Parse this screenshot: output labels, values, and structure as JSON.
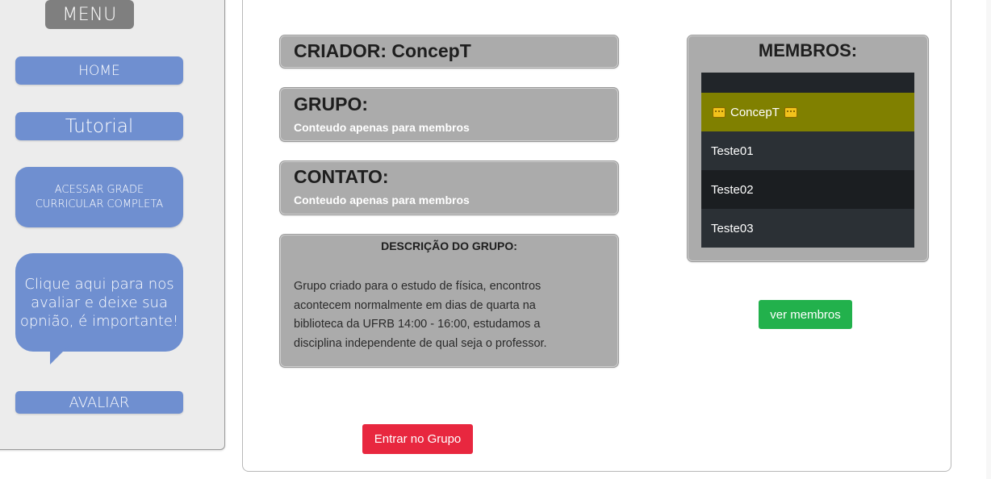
{
  "sidebar": {
    "menu_title": "MENU",
    "home_label": "HOME",
    "tutorial_label": "Tutorial",
    "grade_label": "ACESSAR GRADE CURRICULAR COMPLETA",
    "feedback_bubble": "Clique aqui para nos avaliar e deixe sua opnião, é importante!",
    "avaliar_label": "AVALIAR"
  },
  "group": {
    "criador": "CRIADOR: ConcepT",
    "grupo_heading": "GRUPO:",
    "grupo_text": "Conteudo apenas para membros",
    "contato_heading": "CONTATO:",
    "contato_text": "Conteudo apenas para membros",
    "descricao_title": "DESCRIÇÃO DO GRUPO:",
    "descricao_text": "Grupo criado para o estudo de física, encontros acontecem normalmente em dias de quarta na biblioteca da UFRB 14:00 - 16:00, estudamos a disciplina independente de qual seja o professor.",
    "join_button": "Entrar no Grupo"
  },
  "members": {
    "title": "MEMBROS:",
    "list": [
      "ConcepT",
      "Teste01",
      "Teste02",
      "Teste03"
    ],
    "owner_icon": "crown-icon",
    "view_button": "ver membros"
  },
  "colors": {
    "sidebar_button": "#6f8fd0",
    "join_button": "#e8273f",
    "view_button": "#22b14c",
    "owner_row": "#808000",
    "box_gray": "#ababab"
  }
}
